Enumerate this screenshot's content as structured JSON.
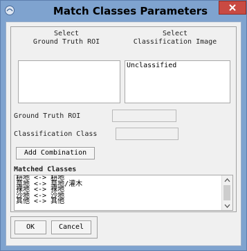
{
  "window": {
    "title": "Match Classes Parameters",
    "app_icon": "idl-icon",
    "close_icon": "close-icon",
    "accent": "#7fa3cf",
    "close_color": "#c94a42"
  },
  "ground_truth": {
    "header_line1": "Select",
    "header_line2": "Ground Truth ROI",
    "items": []
  },
  "classification": {
    "header_line1": "Select",
    "header_line2": "Classification Image",
    "items": [
      "Unclassified"
    ]
  },
  "fields": {
    "ground_truth_roi_label": "Ground Truth ROI",
    "ground_truth_roi_value": "",
    "classification_class_label": "Classification Class",
    "classification_class_value": ""
  },
  "add_combination_label": "Add Combination",
  "matched": {
    "label": "Matched Classes",
    "items": [
      "耕地 <-> 耕地",
      "草地 <-> 草地/灌木",
      "裸地 <-> 裸地",
      "沙地 <-> 沙地",
      "其他 <-> 其他"
    ]
  },
  "buttons": {
    "ok": "OK",
    "cancel": "Cancel"
  }
}
